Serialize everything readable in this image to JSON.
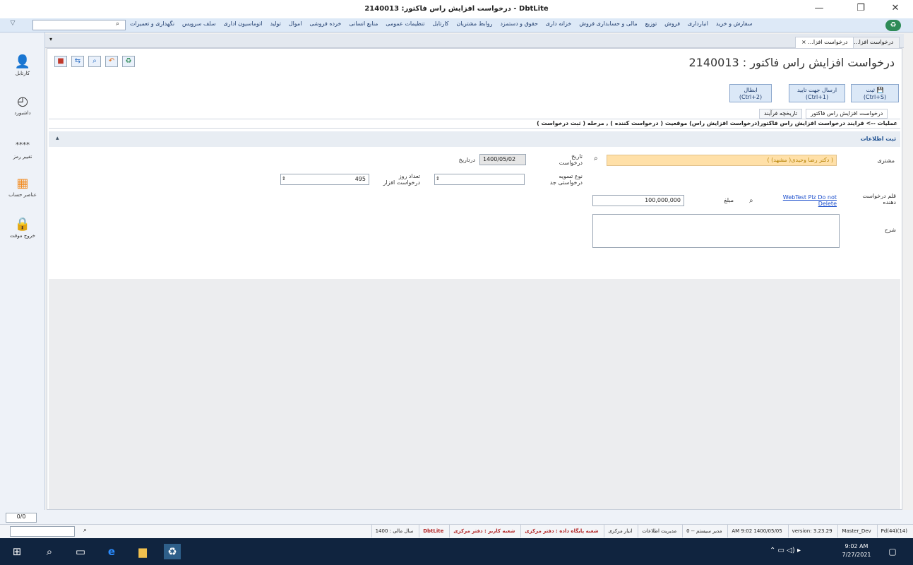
{
  "window": {
    "title": "2140013 :درخواست افزایش راس فاکتور - DbtLite",
    "controls": [
      "—",
      "❐",
      "✕"
    ]
  },
  "menubar": {
    "items": [
      "سفارش و خرید",
      "انبارداری",
      "فروش",
      "توزیع",
      "مالی و حسابداری فروش",
      "خزانه داری",
      "حقوق و دستمزد",
      "روابط مشتریان",
      "کارتابل",
      "تنظیمات عمومی",
      "منابع انسانی",
      "خرده فروشی",
      "اموال",
      "تولید",
      "اتوماسیون اداری",
      "سلف سرویس",
      "نگهداری و تعمیرات"
    ],
    "search_placeholder": ""
  },
  "leftbar": {
    "items": [
      {
        "label": "کارتابل",
        "icon": "user-icon"
      },
      {
        "label": "داشبورد",
        "icon": "dashboard-icon"
      },
      {
        "label": "تغییر رمز",
        "icon": "password-icon"
      },
      {
        "label": "عناصر حساب",
        "icon": "grid-icon"
      },
      {
        "label": "خروج موقت",
        "icon": "lock-icon"
      }
    ]
  },
  "tabs": {
    "primary": [
      "درخواست افزا...",
      "درخواست افزا... ×"
    ],
    "active": 1
  },
  "page": {
    "title": "درخواست افزایش راس فاکتور :  2140013",
    "buttons": {
      "save": "ثبت\n(Ctrl+S)",
      "send": "ارسال جهت تایید\n(Ctrl+1)",
      "cancel": "ابطال\n(Ctrl+2)"
    },
    "subtabs": [
      "درخواست افزایش راس فاکتور",
      "تاریخچه فرآیند"
    ],
    "breadcrumb": "عملیات --> فرایند درخواست افزایش راس فاکتور(درخواست افزایش راس) موقعیت ( درخواست کننده ) , مرحله ( ثبت درخواست )",
    "section_title": "ثبت اطلاعات"
  },
  "form": {
    "customer_label": "مشتری",
    "customer_value": "( دکتر رضا وحیدی( مشهد) )",
    "request_date_label": "تاریخ درخواست",
    "request_date_value": "1400/05/02",
    "dated_label": "درتاریخ",
    "credit_type_label": "نوع تسویه درخواستی جد",
    "credit_type_value": "",
    "days_label": "تعداد روز درخواست افزار",
    "days_value": "495",
    "request_amount_label": "قلم درخواست دهنده",
    "request_amount_link": "WebTest Plz Do not Delete",
    "amount_label": "مبلغ",
    "amount_value": "100,000,000",
    "description_label": "شرح",
    "description_value": ""
  },
  "bottombar": {
    "page_indicator": "0/0"
  },
  "statusbar": {
    "segments": [
      "(14)(44)Pd",
      "Master_Dev",
      "version: 3.23.29",
      "AM 9:02 1400/05/05",
      "مدیر سیستم -- 0",
      "مدیریت اطلاعات",
      "انبار مرکزی",
      "شعبه پایگاه داده : دفتر مرکزی",
      "شعبه کاربر : دفتر مرکزی",
      "DbtLite",
      "سال مالی : 1400"
    ]
  },
  "taskbar": {
    "time": "9:02 AM",
    "date": "7/27/2021"
  },
  "colors": {
    "accent": "#1a4d8f",
    "highlight": "#ffe0a8",
    "taskbar": "#10243f"
  }
}
